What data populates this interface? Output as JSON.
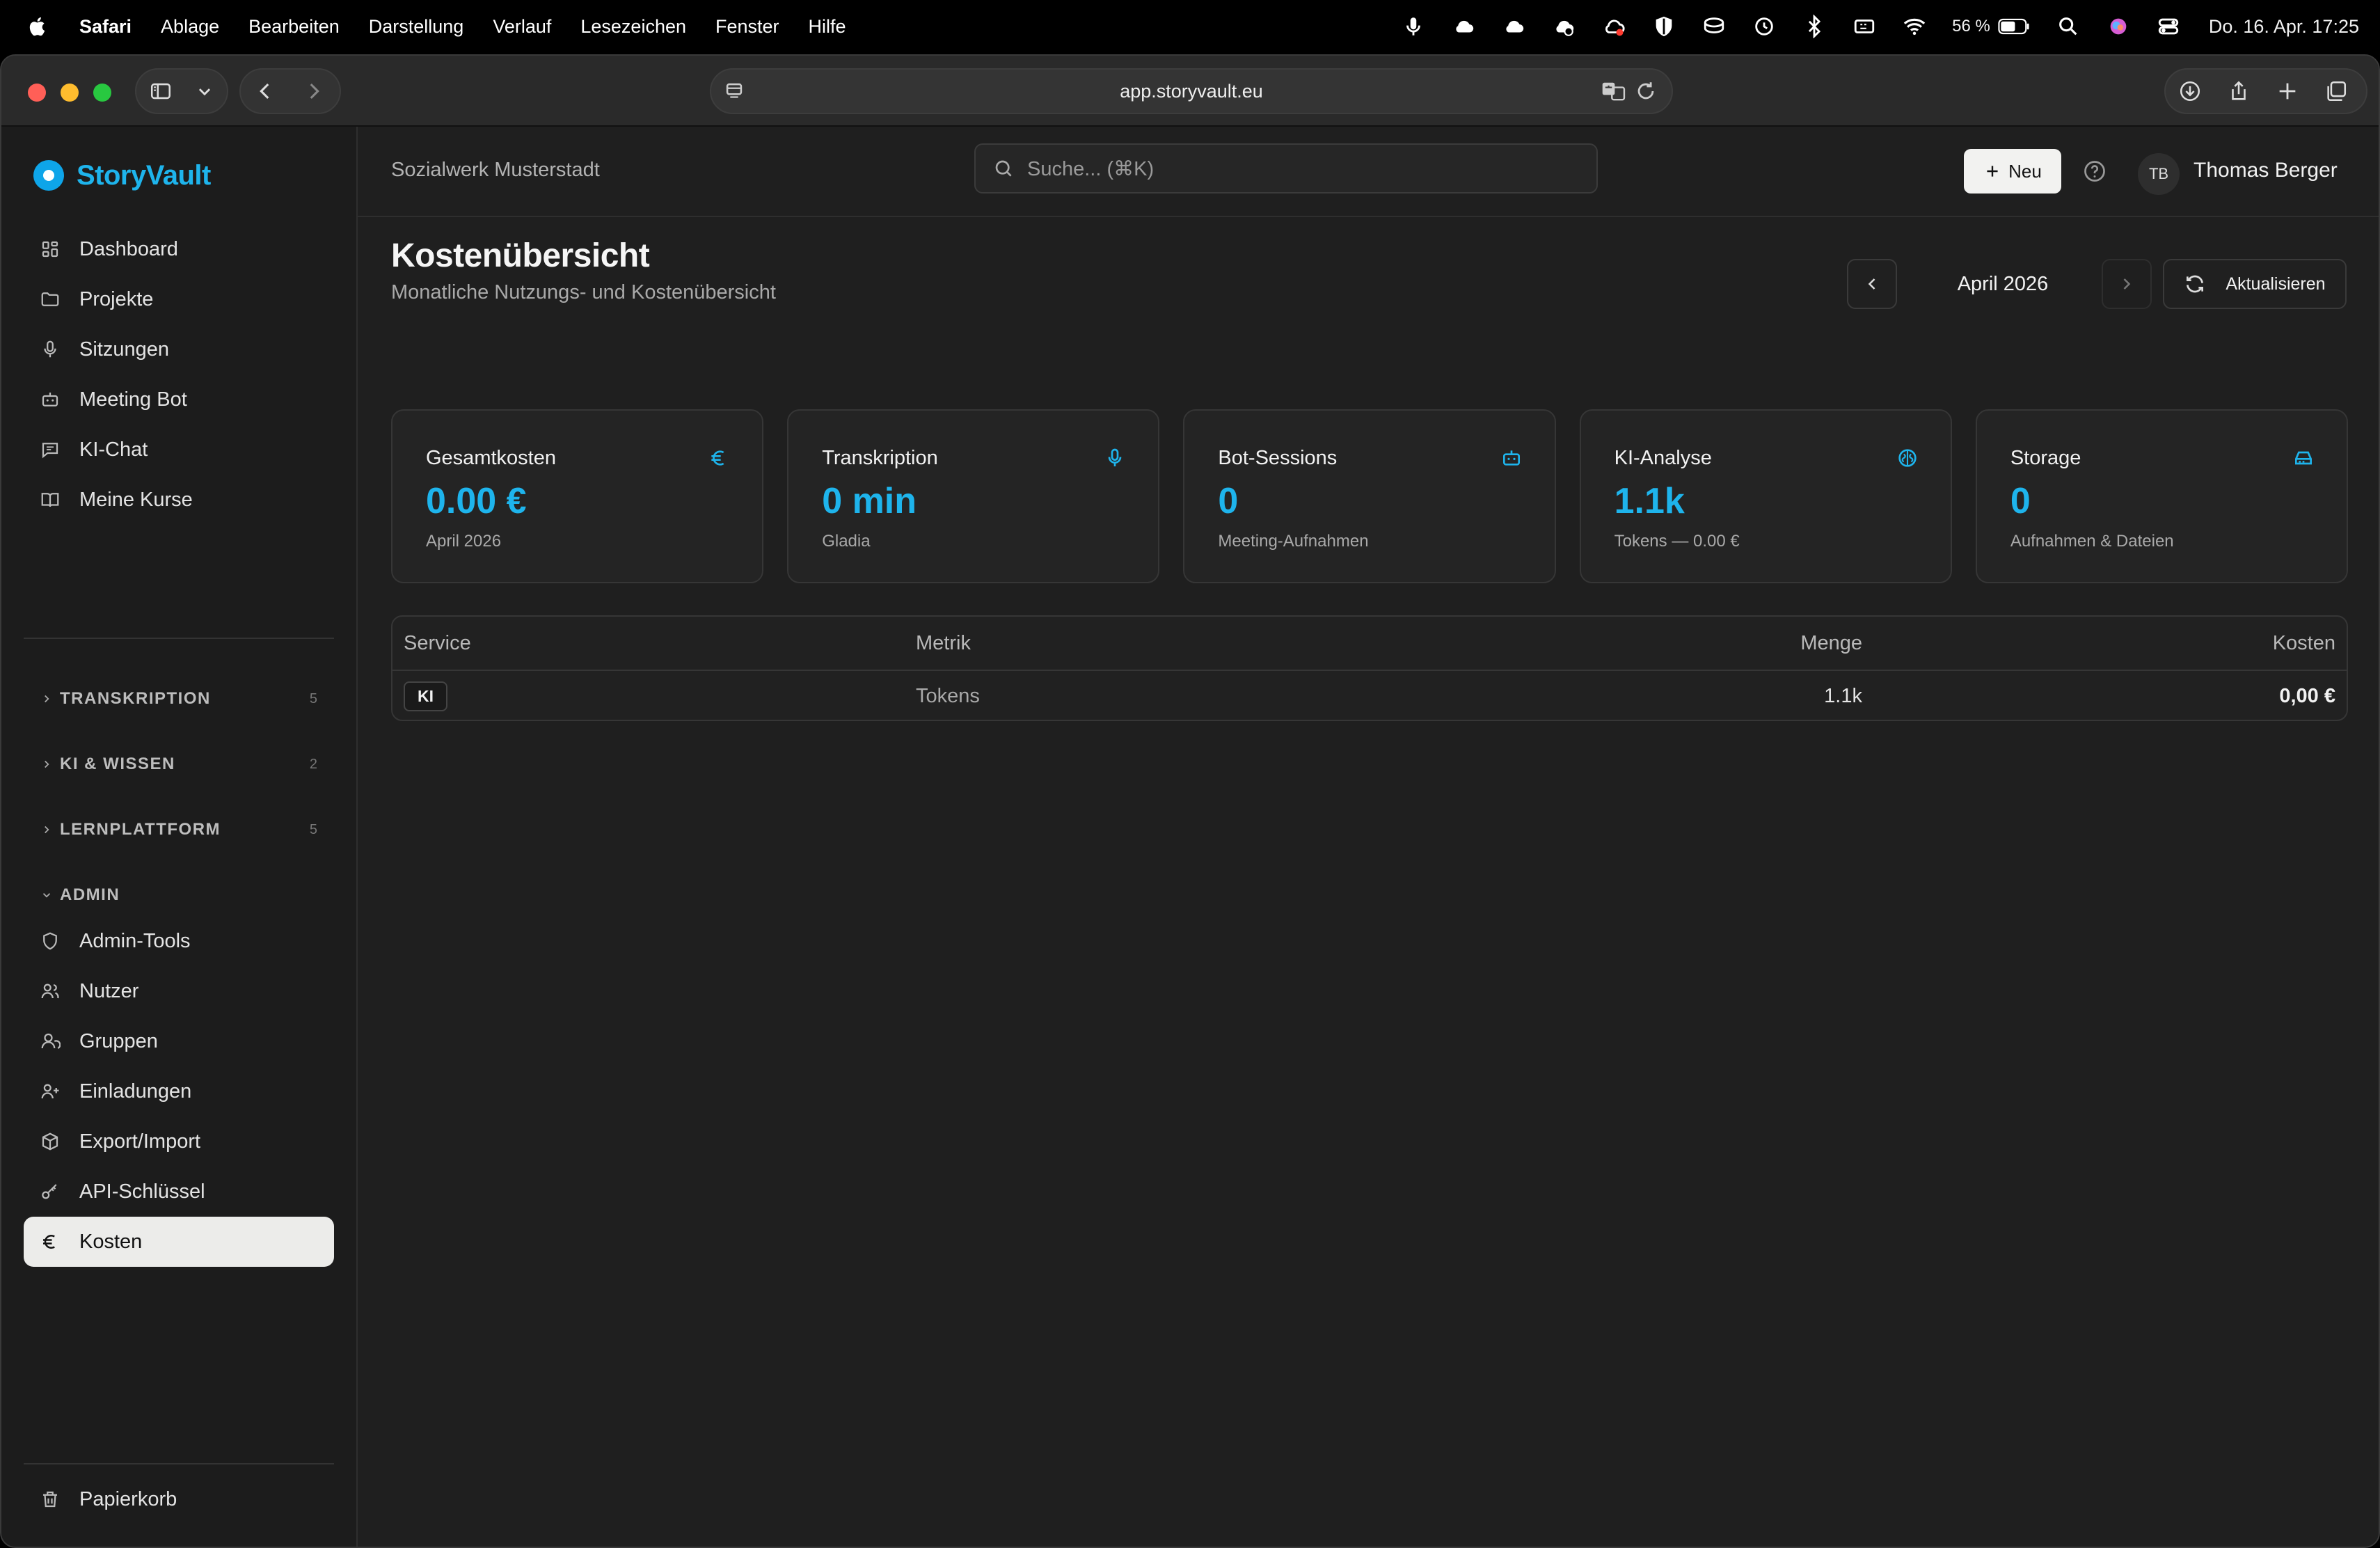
{
  "menubar": {
    "app": "Safari",
    "items": [
      "Ablage",
      "Bearbeiten",
      "Darstellung",
      "Verlauf",
      "Lesezeichen",
      "Fenster",
      "Hilfe"
    ],
    "battery": "56 %",
    "clock": "Do. 16. Apr.  17:25"
  },
  "browser": {
    "url": "app.storyvault.eu"
  },
  "sidebar": {
    "brand": "StoryVault",
    "nav": [
      {
        "label": "Dashboard",
        "icon": "dashboard-icon"
      },
      {
        "label": "Projekte",
        "icon": "folder-icon"
      },
      {
        "label": "Sitzungen",
        "icon": "microphone-icon"
      },
      {
        "label": "Meeting Bot",
        "icon": "bot-icon"
      },
      {
        "label": "KI-Chat",
        "icon": "chat-icon"
      },
      {
        "label": "Meine Kurse",
        "icon": "book-icon"
      }
    ],
    "sections": [
      {
        "title": "TRANSKRIPTION",
        "count": "5",
        "expanded": false
      },
      {
        "title": "KI & WISSEN",
        "count": "2",
        "expanded": false
      },
      {
        "title": "LERNPLATTFORM",
        "count": "5",
        "expanded": false
      },
      {
        "title": "ADMIN",
        "count": "",
        "expanded": true
      }
    ],
    "admin": [
      {
        "label": "Admin-Tools",
        "icon": "shield-icon"
      },
      {
        "label": "Nutzer",
        "icon": "users-icon"
      },
      {
        "label": "Gruppen",
        "icon": "group-icon"
      },
      {
        "label": "Einladungen",
        "icon": "user-plus-icon"
      },
      {
        "label": "Export/Import",
        "icon": "package-icon"
      },
      {
        "label": "API-Schlüssel",
        "icon": "key-icon"
      },
      {
        "label": "Kosten",
        "icon": "euro-icon",
        "active": true
      }
    ],
    "trash": "Papierkorb"
  },
  "header": {
    "org": "Sozialwerk Musterstadt",
    "search_placeholder": "Suche... (⌘K)",
    "new_label": "Neu",
    "avatar_initials": "TB",
    "user_name": "Thomas Berger"
  },
  "page": {
    "title": "Kostenübersicht",
    "subtitle": "Monatliche Nutzungs- und Kostenübersicht",
    "month": "April 2026",
    "refresh_label": "Aktualisieren"
  },
  "cards": [
    {
      "title": "Gesamtkosten",
      "value": "0.00 €",
      "sub": "April 2026",
      "icon": "euro-icon"
    },
    {
      "title": "Transkription",
      "value": "0 min",
      "sub": "Gladia",
      "icon": "microphone-icon"
    },
    {
      "title": "Bot-Sessions",
      "value": "0",
      "sub": "Meeting-Aufnahmen",
      "icon": "bot-icon"
    },
    {
      "title": "KI-Analyse",
      "value": "1.1k",
      "sub": "Tokens — 0.00 €",
      "icon": "brain-icon"
    },
    {
      "title": "Storage",
      "value": "0",
      "sub": "Aufnahmen & Dateien",
      "icon": "hard-drive-icon"
    }
  ],
  "table": {
    "columns": [
      "Service",
      "Metrik",
      "Menge",
      "Kosten"
    ],
    "rows": [
      {
        "service": "KI",
        "metrik": "Tokens",
        "menge": "1.1k",
        "kosten": "0,00 €"
      }
    ]
  },
  "colors": {
    "accent": "#1eb4ec",
    "background": "#1f1f1f",
    "sidebar_bg": "#1c1c1c",
    "card_bg": "#242424",
    "active_nav_bg": "#ececea"
  }
}
